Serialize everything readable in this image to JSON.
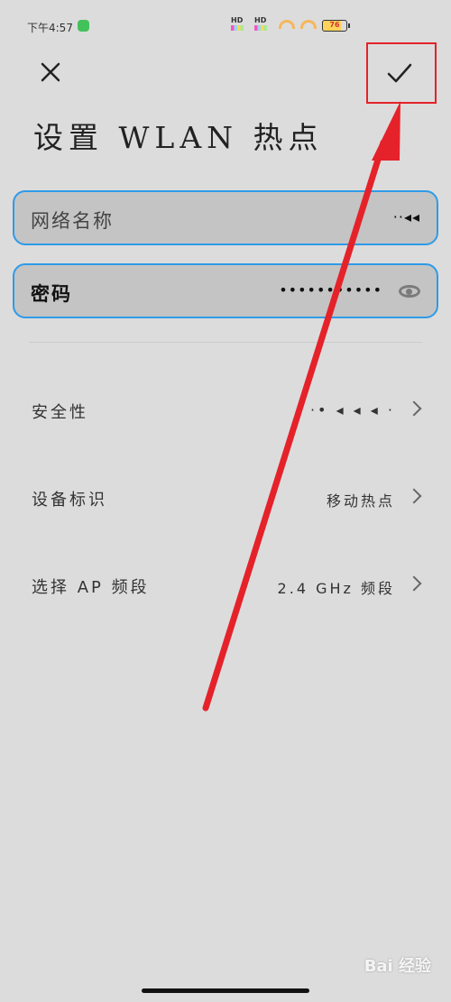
{
  "status_bar": {
    "time": "下午4:57",
    "hd1": "HD",
    "hd2": "HD",
    "battery": "76"
  },
  "header": {
    "title": "设置 WLAN 热点",
    "close_icon": "close-icon",
    "confirm_icon": "checkmark-icon"
  },
  "fields": {
    "ssid": {
      "label": "网络名称",
      "value": "··◂◂"
    },
    "password": {
      "label": "密码",
      "value": "•••••••••••"
    }
  },
  "settings": [
    {
      "label": "安全性",
      "value": "·• ◂ ◂ ◂ ·"
    },
    {
      "label": "设备标识",
      "value": "移动热点"
    },
    {
      "label": "选择 AP 频段",
      "value": "2.4 GHz 频段"
    }
  ],
  "watermark": "Bai 经验",
  "colors": {
    "accent_blue": "#2e9be8",
    "annotation_red": "#e5222a",
    "background": "#dcdcdc"
  }
}
